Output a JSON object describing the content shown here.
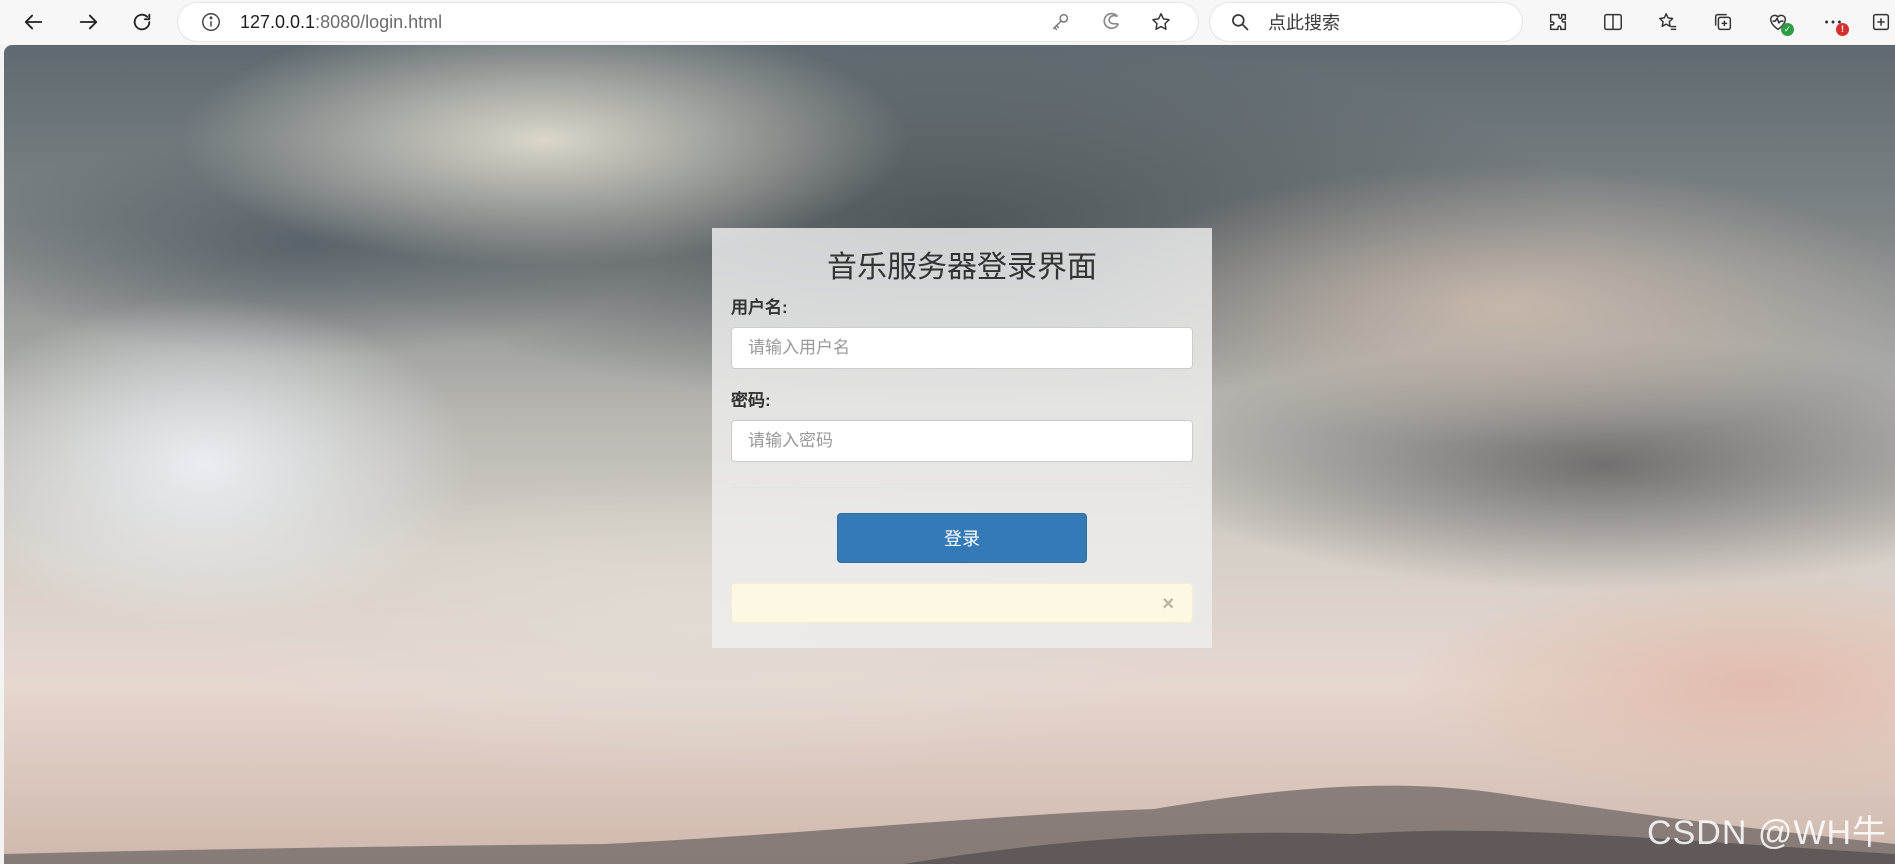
{
  "browser": {
    "url_host": "127.0.0.1",
    "url_rest": ":8080/login.html",
    "search_placeholder": "点此搜索",
    "icons": {
      "back": "arrow-left-icon",
      "forward": "arrow-right-icon",
      "refresh": "refresh-icon",
      "info": "info-icon",
      "key": "key-icon",
      "edge": "edge-icon",
      "favorite": "star-icon",
      "search": "search-icon",
      "extensions": "puzzle-icon",
      "split": "split-screen-icon",
      "favorites": "favorites-icon",
      "collections": "collections-icon",
      "health": "heartbeat-icon",
      "more": "more-icon",
      "new_tab": "new-tab-icon"
    },
    "more_badge": "!"
  },
  "login": {
    "title": "音乐服务器登录界面",
    "username_label": "用户名:",
    "username_placeholder": "请输入用户名",
    "password_label": "密码:",
    "password_placeholder": "请输入密码",
    "submit_label": "登录",
    "alert_close": "×",
    "accent_color": "#337ab7",
    "alert_bg": "#fcf8e3"
  },
  "watermark": "CSDN @WH牛"
}
